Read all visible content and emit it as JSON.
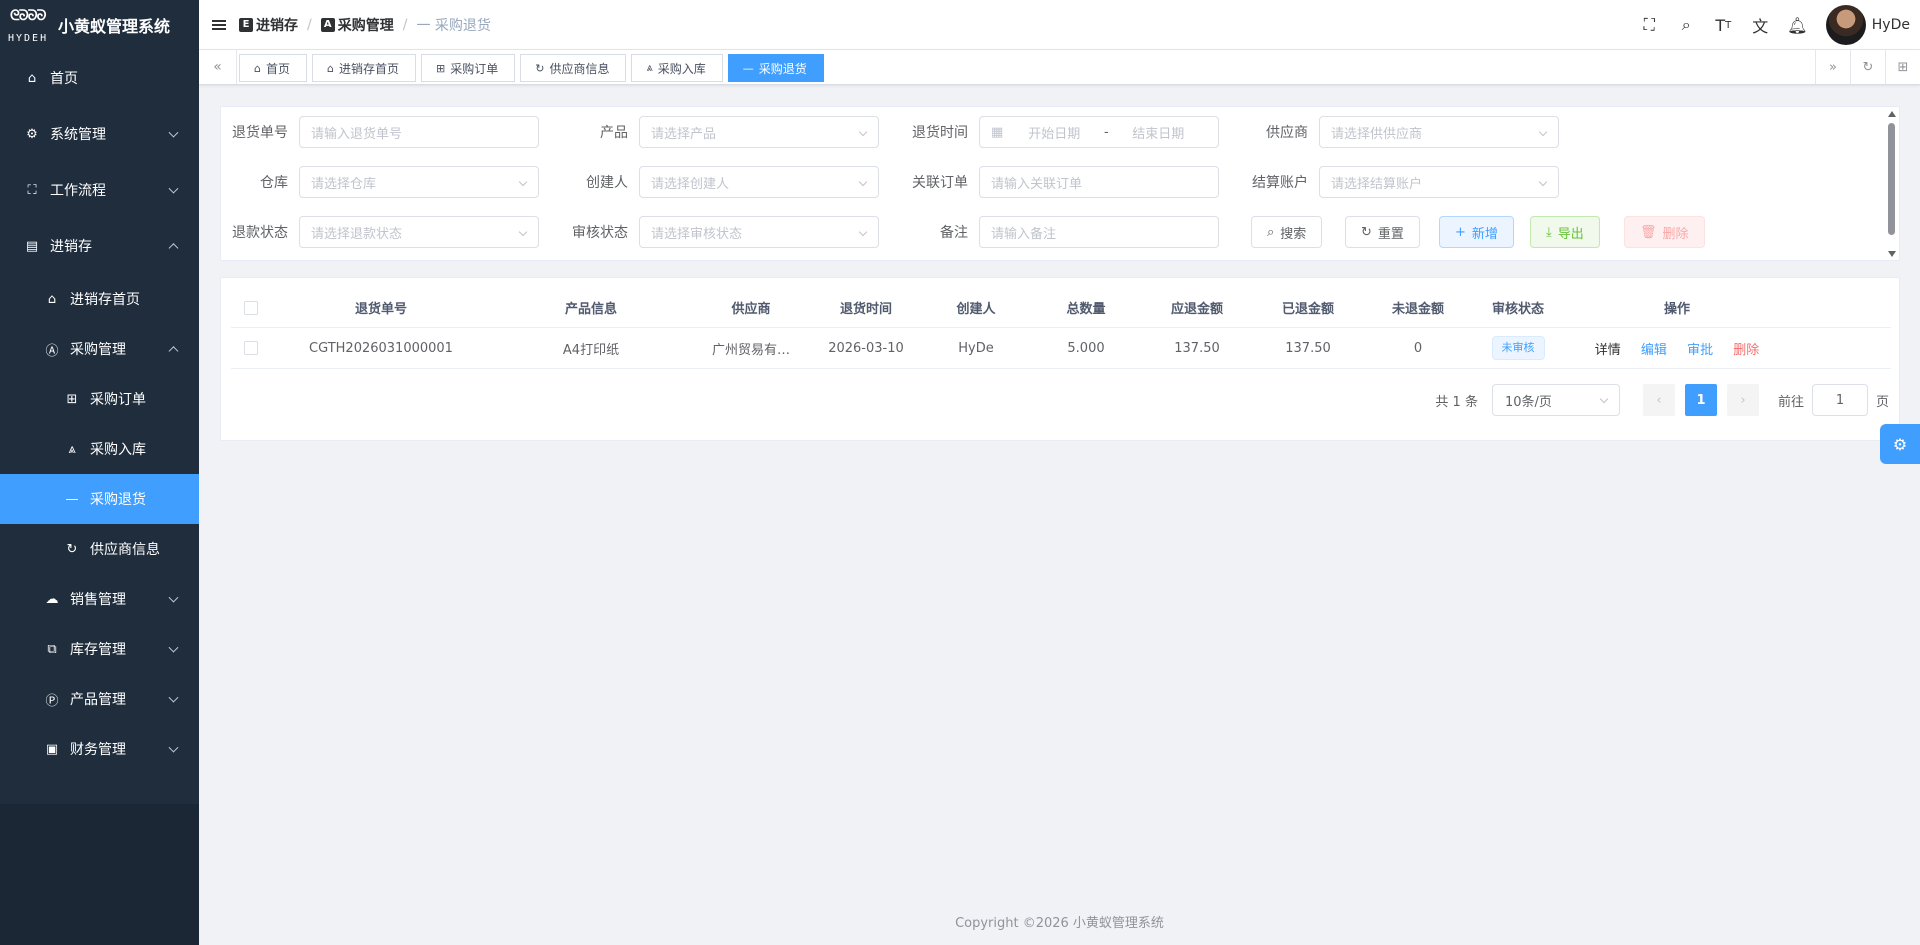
{
  "app": {
    "title": "小黄蚁管理系统",
    "logo_text_top": "ᘓᘐᘐᘐ",
    "logo_text_bottom": "HYDEH"
  },
  "sidebar": {
    "items": [
      {
        "label": "首页",
        "icon": "home-icon"
      },
      {
        "label": "系统管理",
        "icon": "gear-icon"
      },
      {
        "label": "工作流程",
        "icon": "workflow-icon"
      },
      {
        "label": "进销存",
        "icon": "inventory-icon"
      },
      {
        "label": "进销存首页",
        "icon": "home-icon"
      },
      {
        "label": "采购管理",
        "icon": "purchase-icon"
      },
      {
        "label": "采购订单",
        "icon": "grid-icon"
      },
      {
        "label": "采购入库",
        "icon": "warehouse-icon"
      },
      {
        "label": "采购退货",
        "icon": "dash-icon"
      },
      {
        "label": "供应商信息",
        "icon": "refresh-icon"
      },
      {
        "label": "销售管理",
        "icon": "cloud-icon"
      },
      {
        "label": "库存管理",
        "icon": "stack-icon"
      },
      {
        "label": "产品管理",
        "icon": "product-icon"
      },
      {
        "label": "财务管理",
        "icon": "finance-icon"
      }
    ]
  },
  "breadcrumb": {
    "b1": "进销存",
    "b2": "采购管理",
    "b3": "一 采购退货",
    "sep": "/"
  },
  "header": {
    "username": "HyDe"
  },
  "tags": [
    "首页",
    "进销存首页",
    "采购订单",
    "供应商信息",
    "采购入库",
    "采购退货"
  ],
  "form": {
    "return_no": {
      "label": "退货单号",
      "placeholder": "请输入退货单号"
    },
    "product": {
      "label": "产品",
      "placeholder": "请选择产品"
    },
    "return_time": {
      "label": "退货时间",
      "start": "开始日期",
      "sep": "-",
      "end": "结束日期"
    },
    "supplier": {
      "label": "供应商",
      "placeholder": "请选择供供应商"
    },
    "warehouse": {
      "label": "仓库",
      "placeholder": "请选择仓库"
    },
    "creator": {
      "label": "创建人",
      "placeholder": "请选择创建人"
    },
    "related_order": {
      "label": "关联订单",
      "placeholder": "请输入关联订单"
    },
    "settle_account": {
      "label": "结算账户",
      "placeholder": "请选择结算账户"
    },
    "refund_status": {
      "label": "退款状态",
      "placeholder": "请选择退款状态"
    },
    "audit_status": {
      "label": "审核状态",
      "placeholder": "请选择审核状态"
    },
    "remark": {
      "label": "备注",
      "placeholder": "请输入备注"
    }
  },
  "buttons": {
    "search": "搜索",
    "reset": "重置",
    "add": "新增",
    "export": "导出",
    "delete": "删除"
  },
  "table": {
    "headers": [
      "退货单号",
      "产品信息",
      "供应商",
      "退货时间",
      "创建人",
      "总数量",
      "应退金额",
      "已退金额",
      "未退金额",
      "审核状态",
      "操作"
    ],
    "rows": [
      {
        "no": "CGTH2026031000001",
        "product": "A4打印纸",
        "supplier": "广州贸易有…",
        "time": "2026-03-10",
        "creator": "HyDe",
        "qty": "5.000",
        "due": "137.50",
        "refunded": "137.50",
        "unrefunded": "0",
        "status": "未审核",
        "ops": {
          "detail": "详情",
          "edit": "编辑",
          "audit": "审批",
          "delete": "删除"
        }
      }
    ]
  },
  "pagination": {
    "total": "共 1 条",
    "size": "10条/页",
    "current": "1",
    "goto_label": "前往",
    "goto_value": "1",
    "page_suffix": "页"
  },
  "footer": {
    "copyright": "Copyright ©2026 小黄蚁管理系统"
  },
  "colors": {
    "primary": "#409eff",
    "sidebar_bg": "#1f2d3d",
    "danger": "#f56c6c",
    "success": "#67c23a"
  }
}
